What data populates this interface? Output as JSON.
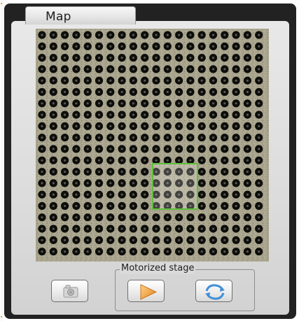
{
  "map_panel": {
    "tab_label": "Map",
    "sample_grid": {
      "rows": 20,
      "cols": 20
    }
  },
  "motorized_stage": {
    "group_label": "Motorized stage"
  },
  "buttons": {
    "capture_icon": "camera-icon",
    "start_icon": "play-icon",
    "refresh_icon": "refresh-icon"
  },
  "colors": {
    "roi": "#5cbf3a",
    "play": "#f2a23c",
    "refresh": "#3f8fd6",
    "frame": "#222222"
  }
}
